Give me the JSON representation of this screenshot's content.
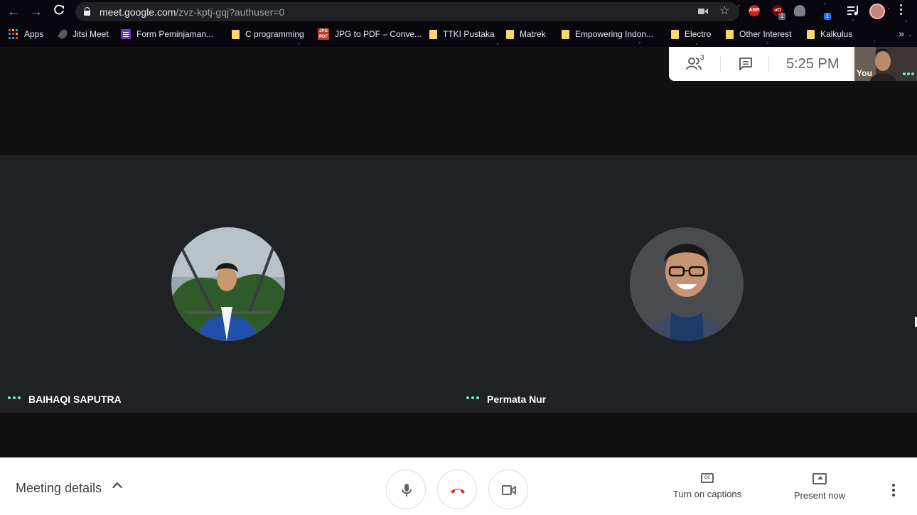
{
  "browser": {
    "url_host": "meet.google.com",
    "url_path": "/zvz-kptj-gqj?authuser=0",
    "extensions": [
      {
        "icon": "adblock-icon",
        "text": "ABP",
        "color": "#c9231e"
      },
      {
        "icon": "ublock-icon",
        "text": "uO",
        "color": "#800000",
        "badge": "1"
      },
      {
        "icon": "cloud-extension-icon",
        "text": "",
        "color": "#9aa0a6"
      },
      {
        "icon": "counter-extension-icon",
        "text": "",
        "color": "#1a73e8",
        "badge": "1"
      }
    ]
  },
  "bookmarks": [
    {
      "label": "Apps",
      "icon": "apps-grid-icon"
    },
    {
      "label": "Jitsi Meet",
      "icon": "feather-icon"
    },
    {
      "label": "Form Peminjaman...",
      "icon": "google-forms-icon"
    },
    {
      "label": "C programming",
      "icon": "folder-icon"
    },
    {
      "label": "JPG to PDF – Conve...",
      "icon": "jpg-pdf-icon"
    },
    {
      "label": "TTKI Pustaka",
      "icon": "folder-icon"
    },
    {
      "label": "Matrek",
      "icon": "folder-icon"
    },
    {
      "label": "Empowering Indon...",
      "icon": "folder-icon"
    },
    {
      "label": "Electro",
      "icon": "folder-icon"
    },
    {
      "label": "Other Interest",
      "icon": "folder-icon"
    },
    {
      "label": "Kalkulus",
      "icon": "folder-icon"
    }
  ],
  "bookmarks_more": "»",
  "meet": {
    "participant_count": "3",
    "clock": "5:25  PM",
    "self_label": "You",
    "participants": [
      {
        "name": "BAIHAQI SAPUTRA"
      },
      {
        "name": "Permata Nur"
      }
    ],
    "bottom": {
      "meeting_details": "Meeting details",
      "captions_label": "Turn on captions",
      "captions_icon_text": "CC",
      "present_label": "Present now"
    },
    "colors": {
      "tile_bg": "#202124",
      "stage_bg": "#111111",
      "hangup_red": "#d93025",
      "active_dots": "#5ff2d4"
    }
  }
}
